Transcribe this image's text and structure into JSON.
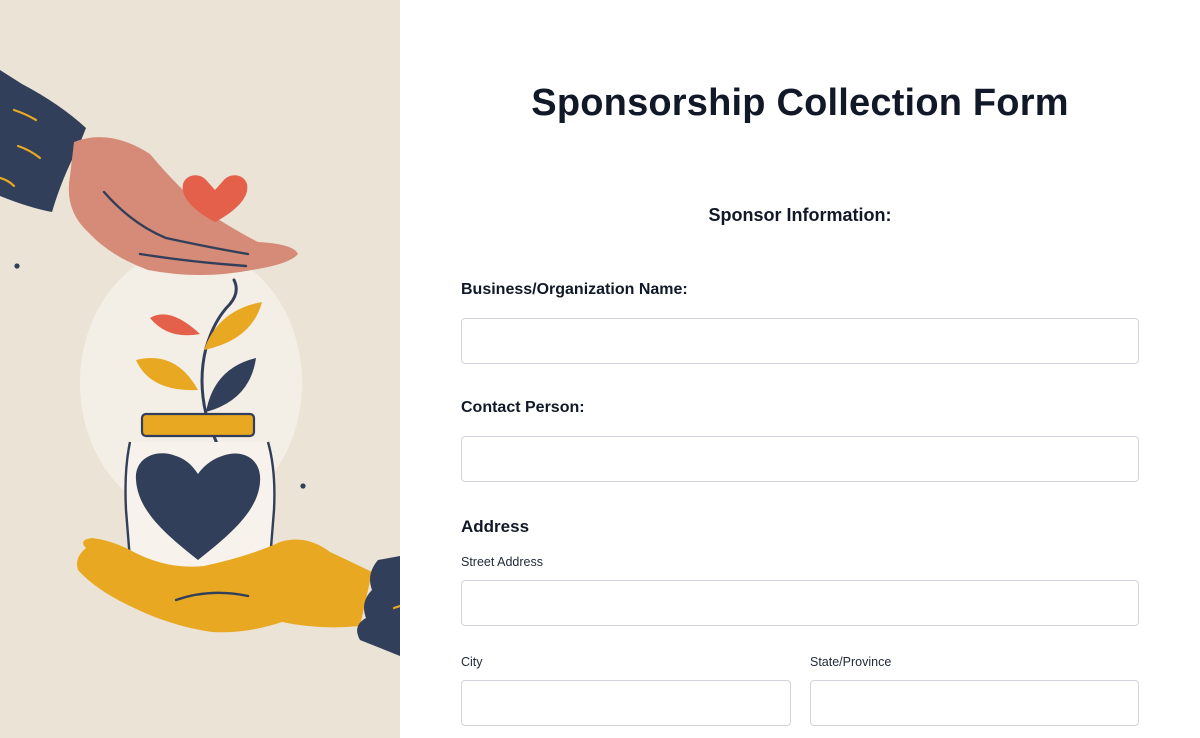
{
  "form": {
    "title": "Sponsorship Collection Form",
    "section_title": "Sponsor Information:",
    "business_name": {
      "label": "Business/Organization Name:",
      "value": ""
    },
    "contact_person": {
      "label": "Contact Person:",
      "value": ""
    },
    "address": {
      "label": "Address",
      "street": {
        "label": "Street Address",
        "value": ""
      },
      "city": {
        "label": "City",
        "value": ""
      },
      "state": {
        "label": "State/Province",
        "value": ""
      }
    }
  },
  "illustration": {
    "name": "hands-giving-heart-jar",
    "colors": {
      "background": "#ebe3d6",
      "circle": "#f4efe6",
      "navy": "#323f5a",
      "peach": "#d58b77",
      "coral": "#e4604a",
      "mustard": "#e8a822"
    }
  }
}
